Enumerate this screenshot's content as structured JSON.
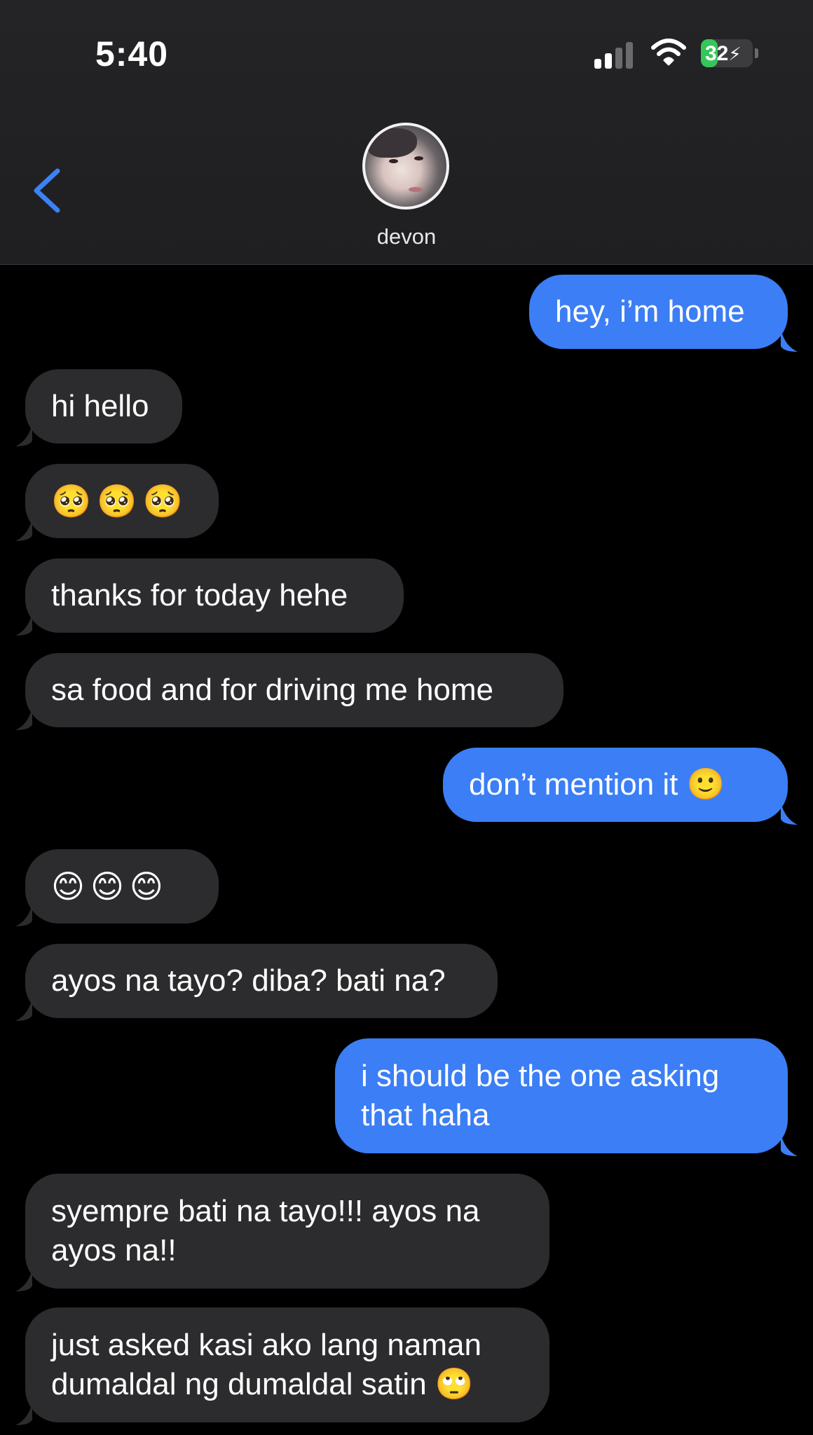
{
  "status_bar": {
    "time": "5:40",
    "battery_level": "32",
    "battery_fraction": 0.32,
    "battery_color": "#35c759"
  },
  "header": {
    "contact_name": "devon",
    "back_icon": "chevron-left-icon",
    "accent_color": "#3b82f6"
  },
  "messages": [
    {
      "direction": "outgoing",
      "text": "hey, i’m home"
    },
    {
      "direction": "incoming",
      "text": "hi hello"
    },
    {
      "direction": "incoming",
      "text": "🥺🥺🥺"
    },
    {
      "direction": "incoming",
      "text": "thanks for today hehe"
    },
    {
      "direction": "incoming",
      "text": "sa food and for driving me home"
    },
    {
      "direction": "outgoing",
      "text": "don’t mention it 🙂"
    },
    {
      "direction": "incoming",
      "text": "😊😊😊"
    },
    {
      "direction": "incoming",
      "text": "ayos na tayo? diba? bati na?"
    },
    {
      "direction": "outgoing",
      "lines": [
        "i should be the one asking",
        "that haha"
      ]
    },
    {
      "direction": "incoming",
      "lines": [
        "syempre bati na tayo!!! ayos na",
        "ayos na!!"
      ]
    },
    {
      "direction": "incoming",
      "lines": [
        "just asked kasi ako lang naman",
        "dumaldal ng dumaldal satin 🙄"
      ]
    }
  ],
  "colors": {
    "incoming_bubble": "#2c2c2e",
    "outgoing_bubble": "#3b7ef5",
    "background": "#000000"
  }
}
